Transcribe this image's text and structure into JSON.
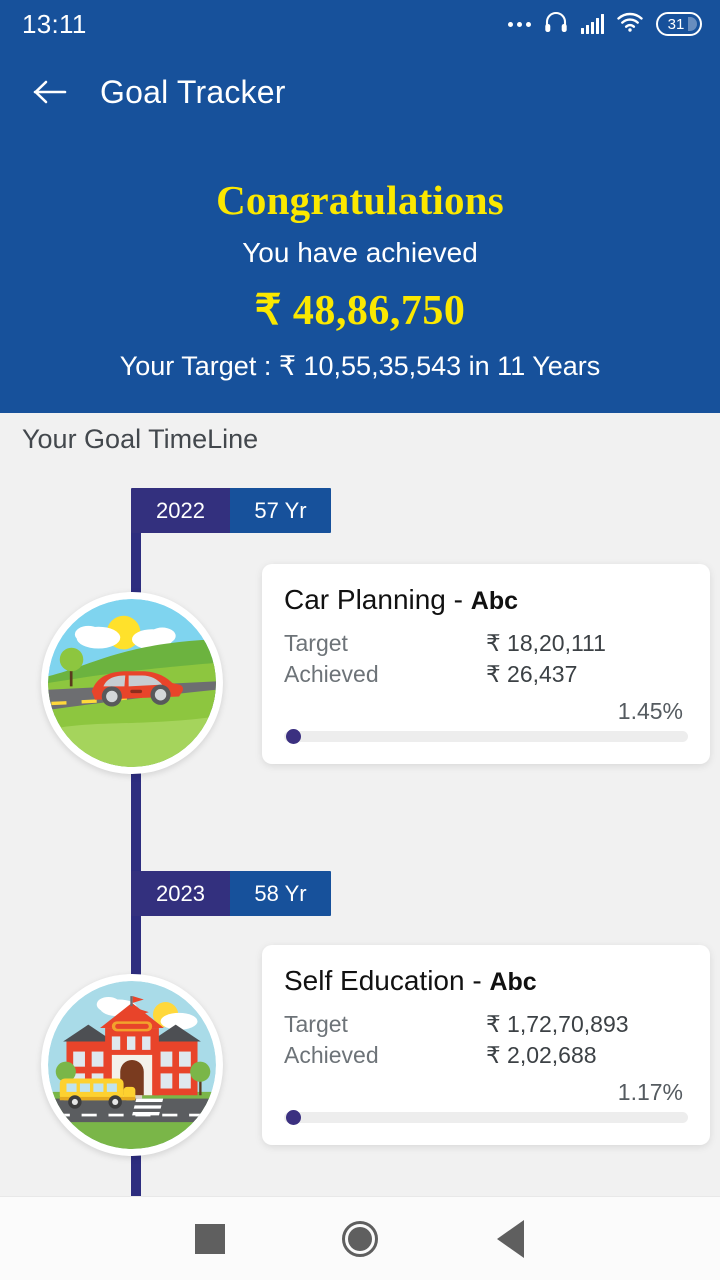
{
  "status_bar": {
    "time": "13:11",
    "icons": [
      "more-dots-icon",
      "headphones-icon",
      "signal-bars-icon",
      "wifi-icon",
      "battery-icon"
    ],
    "battery_level": "31"
  },
  "header": {
    "back_icon": "back-arrow-icon",
    "title": "Goal Tracker",
    "background_color": "#17519b"
  },
  "hero": {
    "congratulations": "Congratulations",
    "subtitle": "You have achieved",
    "achieved_amount": "₹ 48,86,750",
    "target_line": "Your Target : ₹ 10,55,35,543 in 11 Years",
    "accent_color": "#fbe800"
  },
  "timeline": {
    "section_title": "Your Goal TimeLine",
    "spine_color": "#2d2d7f",
    "entries": [
      {
        "year": "2022",
        "age": "57 Yr",
        "illustration": "car-on-road-icon",
        "goal_name": "Car Planning",
        "goal_sub": "Abc",
        "separator": "-",
        "target_label": "Target",
        "target_value": "₹ 18,20,111",
        "achieved_label": "Achieved",
        "achieved_value": "₹ 26,437",
        "percent": "1.45%",
        "progress_value": 1.45
      },
      {
        "year": "2023",
        "age": "58 Yr",
        "illustration": "school-building-icon",
        "goal_name": "Self Education",
        "goal_sub": "Abc",
        "separator": "-",
        "target_label": "Target",
        "target_value": "₹ 1,72,70,893",
        "achieved_label": "Achieved",
        "achieved_value": "₹ 2,02,688",
        "percent": "1.17%",
        "progress_value": 1.17
      }
    ]
  },
  "nav_bar": {
    "recents": "recents-square-icon",
    "home": "home-circle-icon",
    "back": "back-triangle-icon"
  }
}
